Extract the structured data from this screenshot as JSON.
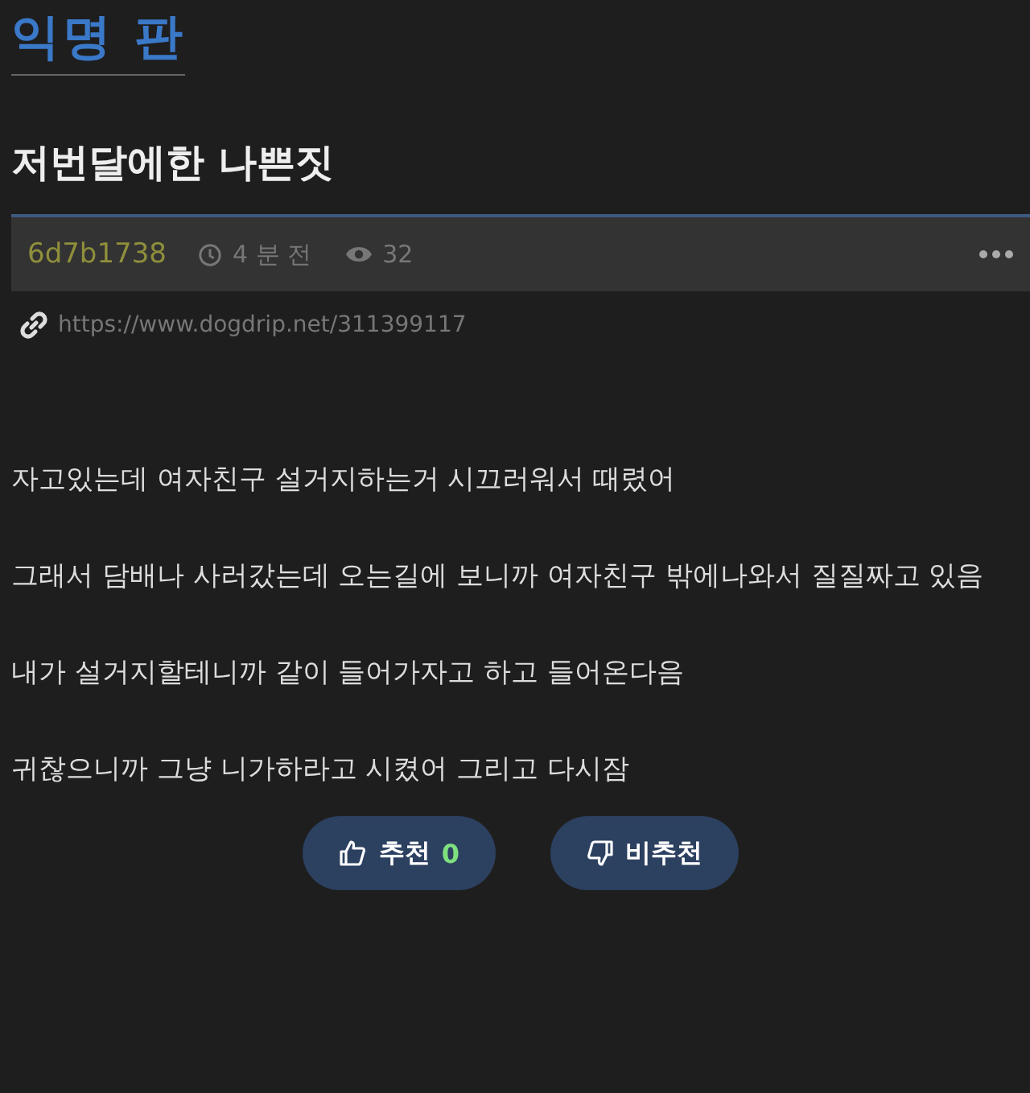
{
  "board": {
    "title": "익명 판"
  },
  "post": {
    "title": "저번달에한 나쁜짓",
    "author": "6d7b1738",
    "time": "4 분 전",
    "views": "32",
    "url": "https://www.dogdrip.net/311399117",
    "paragraphs": [
      "자고있는데 여자친구 설거지하는거 시끄러워서 때렸어",
      "그래서 담배나 사러갔는데 오는길에 보니까 여자친구 밖에나와서 질질짜고 있음",
      "내가 설거지할테니까 같이 들어가자고 하고 들어온다음",
      "귀찮으니까 그냥 니가하라고 시켰어 그리고 다시잠"
    ]
  },
  "votes": [
    {
      "kind": "up",
      "label": "추천",
      "count": "0"
    },
    {
      "kind": "down",
      "label": "비추천"
    }
  ]
}
